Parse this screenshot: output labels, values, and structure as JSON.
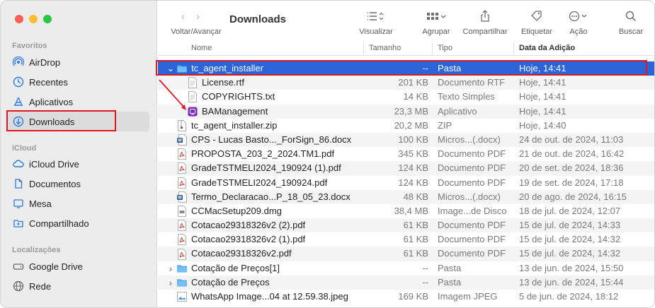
{
  "sidebar": {
    "favoritos_label": "Favoritos",
    "favoritos": [
      {
        "label": "AirDrop",
        "icon": "airdrop-icon"
      },
      {
        "label": "Recentes",
        "icon": "clock-icon"
      },
      {
        "label": "Aplicativos",
        "icon": "apps-icon"
      },
      {
        "label": "Downloads",
        "icon": "download-icon",
        "selected": true
      }
    ],
    "icloud_label": "iCloud",
    "icloud": [
      {
        "label": "iCloud Drive",
        "icon": "cloud-icon"
      },
      {
        "label": "Documentos",
        "icon": "document-icon"
      },
      {
        "label": "Mesa",
        "icon": "desktop-icon"
      },
      {
        "label": "Compartilhado",
        "icon": "shared-folder-icon"
      }
    ],
    "locais_label": "Localizações",
    "locais": [
      {
        "label": "Google Drive",
        "icon": "drive-icon"
      },
      {
        "label": "Rede",
        "icon": "globe-icon"
      }
    ]
  },
  "toolbar": {
    "title": "Downloads",
    "back_forward_label": "Voltar/Avançar",
    "view_label": "Visualizar",
    "group_label": "Agrupar",
    "share_label": "Compartilhar",
    "tag_label": "Etiquetar",
    "action_label": "Ação",
    "search_label": "Buscar"
  },
  "columns": {
    "name": "Nome",
    "size": "Tamanho",
    "kind": "Tipo",
    "date": "Data da Adição"
  },
  "rows": [
    {
      "name": "tc_agent_installer",
      "size": "--",
      "kind": "Pasta",
      "date": "Hoje, 14:41",
      "icon": "folder",
      "disclosure": "open",
      "indent": 0,
      "selected": true
    },
    {
      "name": "License.rtf",
      "size": "201 KB",
      "kind": "Documento RTF",
      "date": "Hoje, 14:41",
      "icon": "doc",
      "indent": 1
    },
    {
      "name": "COPYRIGHTS.txt",
      "size": "14 KB",
      "kind": "Texto Simples",
      "date": "Hoje, 14:41",
      "icon": "doc",
      "indent": 1
    },
    {
      "name": "BAManagement",
      "size": "23,3 MB",
      "kind": "Aplicativo",
      "date": "Hoje, 14:41",
      "icon": "app",
      "indent": 1
    },
    {
      "name": "tc_agent_installer.zip",
      "size": "20,2 MB",
      "kind": "ZIP",
      "date": "Hoje, 14:40",
      "icon": "zip",
      "indent": 0
    },
    {
      "name": "CPS - Lucas Basto..._ForSign_86.docx",
      "size": "100 KB",
      "kind": "Micros...(.docx)",
      "date": "24 de out. de 2024, 11:03",
      "icon": "word",
      "indent": 0
    },
    {
      "name": "PROPOSTA_203_2_2024.TM1.pdf",
      "size": "345 KB",
      "kind": "Documento PDF",
      "date": "21 de out. de 2024, 16:42",
      "icon": "pdf",
      "indent": 0
    },
    {
      "name": "GradeTSTMELI2024_190924 (1).pdf",
      "size": "124 KB",
      "kind": "Documento PDF",
      "date": "20 de set. de 2024, 18:36",
      "icon": "pdf",
      "indent": 0
    },
    {
      "name": "GradeTSTMELI2024_190924.pdf",
      "size": "124 KB",
      "kind": "Documento PDF",
      "date": "19 de set. de 2024, 17:18",
      "icon": "pdf",
      "indent": 0
    },
    {
      "name": "Termo_Declaracao...P_18_05_23.docx",
      "size": "48 KB",
      "kind": "Micros...(.docx)",
      "date": "20 de ago. de 2024, 16:15",
      "icon": "word",
      "indent": 0
    },
    {
      "name": "CCMacSetup209.dmg",
      "size": "38,4 MB",
      "kind": "Image...de Disco",
      "date": "18 de jul. de 2024, 12:07",
      "icon": "dmg",
      "indent": 0
    },
    {
      "name": "Cotacao29318326v2 (2).pdf",
      "size": "61 KB",
      "kind": "Documento PDF",
      "date": "15 de jul. de 2024, 14:33",
      "icon": "pdf",
      "indent": 0
    },
    {
      "name": "Cotacao29318326v2 (1).pdf",
      "size": "61 KB",
      "kind": "Documento PDF",
      "date": "15 de jul. de 2024, 14:32",
      "icon": "pdf",
      "indent": 0
    },
    {
      "name": "Cotacao29318326v2.pdf",
      "size": "61 KB",
      "kind": "Documento PDF",
      "date": "15 de jul. de 2024, 14:32",
      "icon": "pdf",
      "indent": 0
    },
    {
      "name": "Cotação de Preços[1]",
      "size": "--",
      "kind": "Pasta",
      "date": "13 de jun. de 2024, 15:50",
      "icon": "folder",
      "disclosure": "closed",
      "indent": 0
    },
    {
      "name": "Cotação de Preços",
      "size": "--",
      "kind": "Pasta",
      "date": "13 de jun. de 2024, 15:44",
      "icon": "folder",
      "disclosure": "closed",
      "indent": 0
    },
    {
      "name": "WhatsApp Image...04 at 12.59.38.jpeg",
      "size": "169 KB",
      "kind": "Imagem JPEG",
      "date": "5 de jun. de 2024, 18:12",
      "icon": "image",
      "indent": 0
    }
  ],
  "colors": {
    "selection": "#2b64d9",
    "highlight_box": "#e0171f",
    "accent": "#2a7ae2"
  }
}
